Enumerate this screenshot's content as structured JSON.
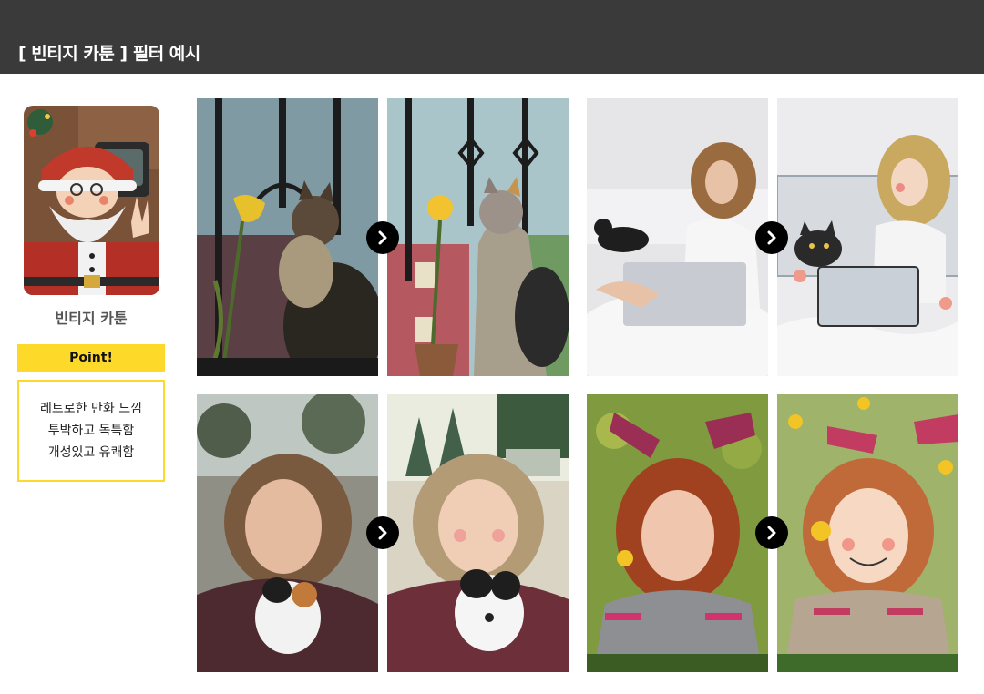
{
  "header": {
    "title": "[ 빈티지 카툰 ] 필터 예시"
  },
  "sidebar": {
    "thumbnail_icon": "santa-cartoon-thumbnail",
    "label": "빈티지 카툰",
    "point_label": "Point!",
    "point_lines": [
      "레트로한 만화 느낌",
      "투박하고 독특함",
      "개성있고 유쾌함"
    ]
  },
  "examples": [
    {
      "before": "photo-cat-with-daffodil",
      "after": "cartoon-cat-with-daffodil",
      "arrow_icon": "chevron-right-icon"
    },
    {
      "before": "photo-woman-with-laptop-and-cat",
      "after": "cartoon-woman-with-laptop-and-cat",
      "arrow_icon": "chevron-right-icon"
    },
    {
      "before": "photo-girl-holding-puppy",
      "after": "cartoon-girl-holding-puppy",
      "arrow_icon": "chevron-right-icon"
    },
    {
      "before": "photo-red-haired-girl-with-flower",
      "after": "cartoon-red-haired-girl-with-flower",
      "arrow_icon": "chevron-right-icon"
    }
  ],
  "colors": {
    "header_bg": "#3a3a3a",
    "accent_yellow": "#fdd92a",
    "arrow_bg": "#000000"
  }
}
